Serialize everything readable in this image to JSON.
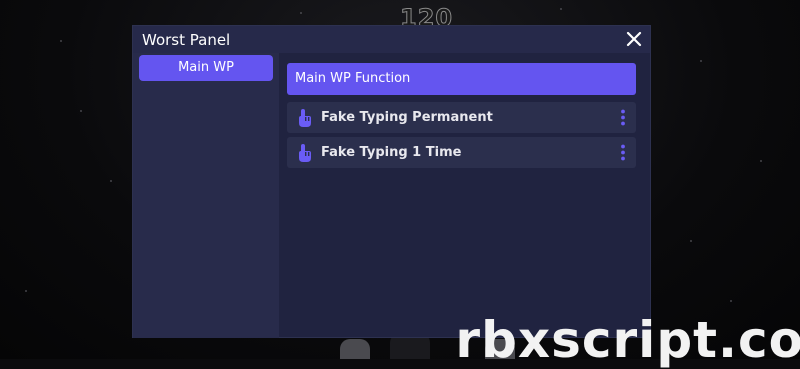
{
  "background": {
    "counter_text": "120",
    "watermark_text": "rbxscript.co"
  },
  "panel": {
    "title": "Worst Panel",
    "close_icon": "close-icon",
    "colors": {
      "accent": "#6455f0",
      "panel_bg": "#202340",
      "sidebar_bg": "#282b4b",
      "item_bg": "#2b2f4d",
      "icon_color": "#6a5cf5"
    }
  },
  "sidebar": {
    "tabs": [
      {
        "label": "Main WP"
      }
    ]
  },
  "main": {
    "section_title": "Main WP Function",
    "items": [
      {
        "label": "Fake Typing Permanent",
        "icon": "tap-hand-icon",
        "menu_icon": "more-vertical-icon"
      },
      {
        "label": "Fake Typing 1 Time",
        "icon": "tap-hand-icon",
        "menu_icon": "more-vertical-icon"
      }
    ]
  }
}
